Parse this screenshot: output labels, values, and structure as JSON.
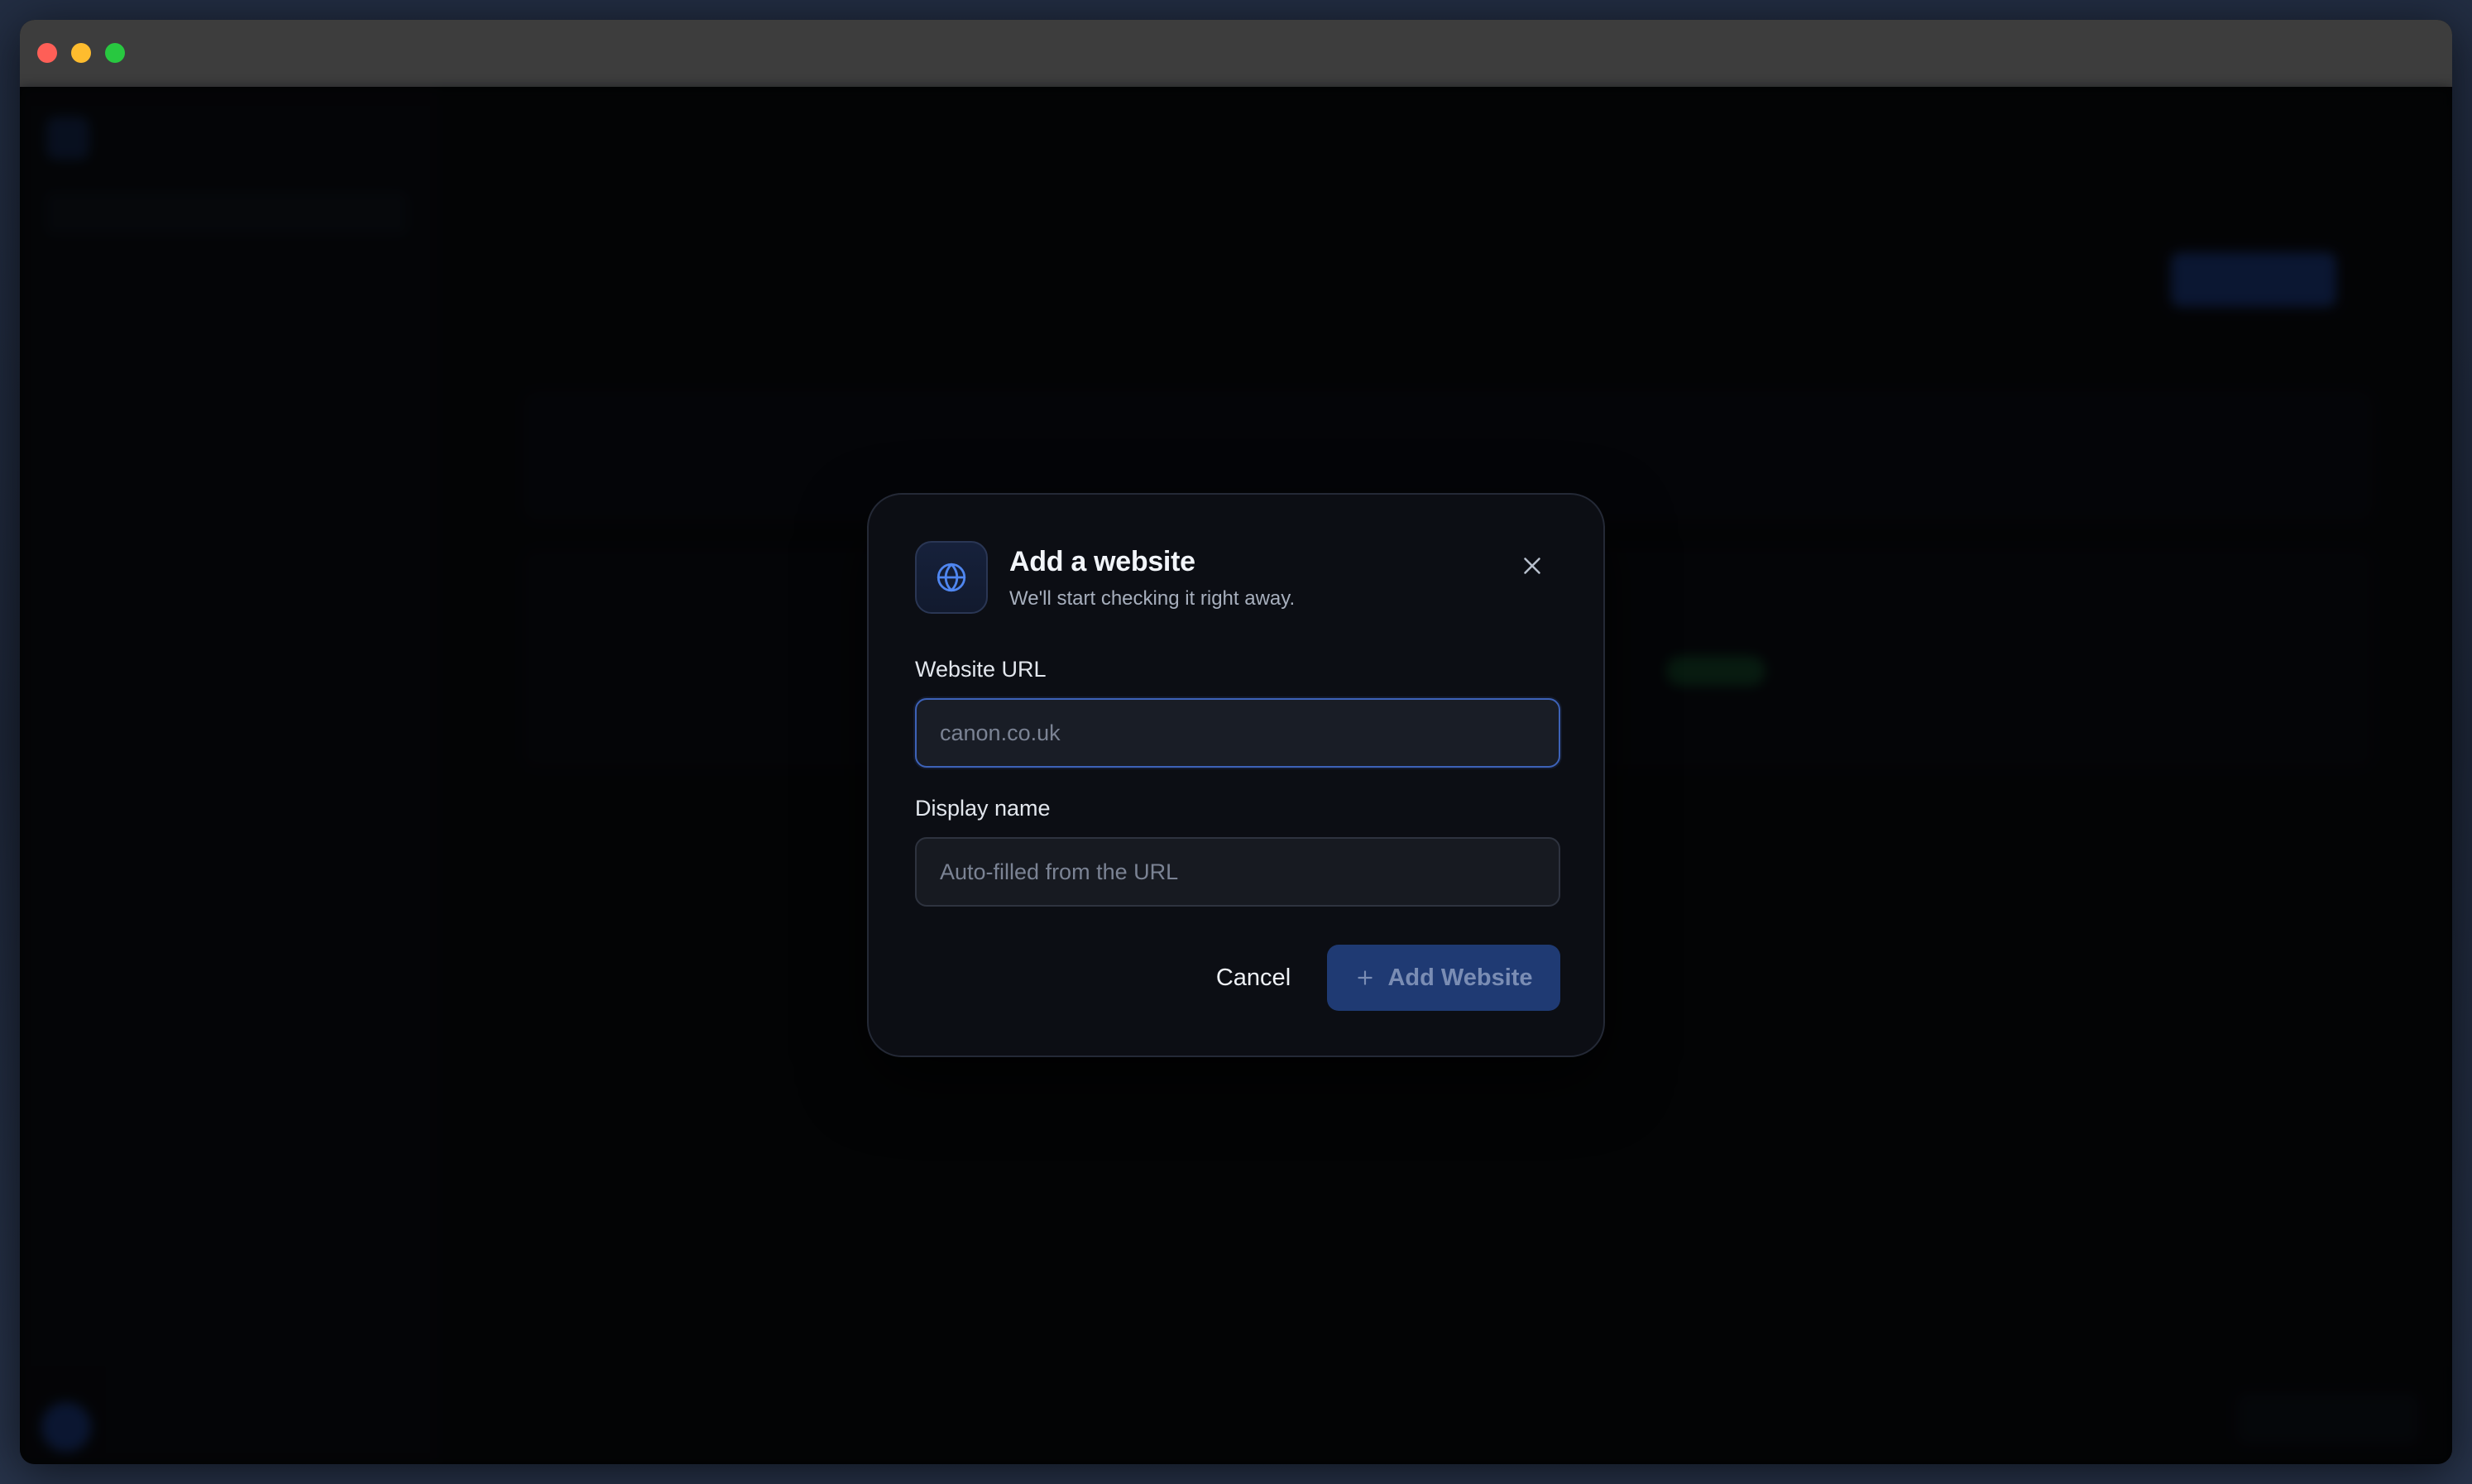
{
  "modal": {
    "title": "Add a website",
    "subtitle": "We'll start checking it right away.",
    "icon": "globe-icon",
    "close_icon": "close-icon",
    "fields": {
      "url": {
        "label": "Website URL",
        "value": "",
        "placeholder": "canon.co.uk"
      },
      "display_name": {
        "label": "Display name",
        "value": "",
        "placeholder": "Auto-filled from the URL"
      }
    },
    "buttons": {
      "cancel_label": "Cancel",
      "add_label": "Add Website",
      "add_icon": "plus-icon"
    }
  },
  "colors": {
    "accent": "#3d62b8",
    "primary_button": "#1f3a73",
    "modal_background": "#0c0e14"
  }
}
